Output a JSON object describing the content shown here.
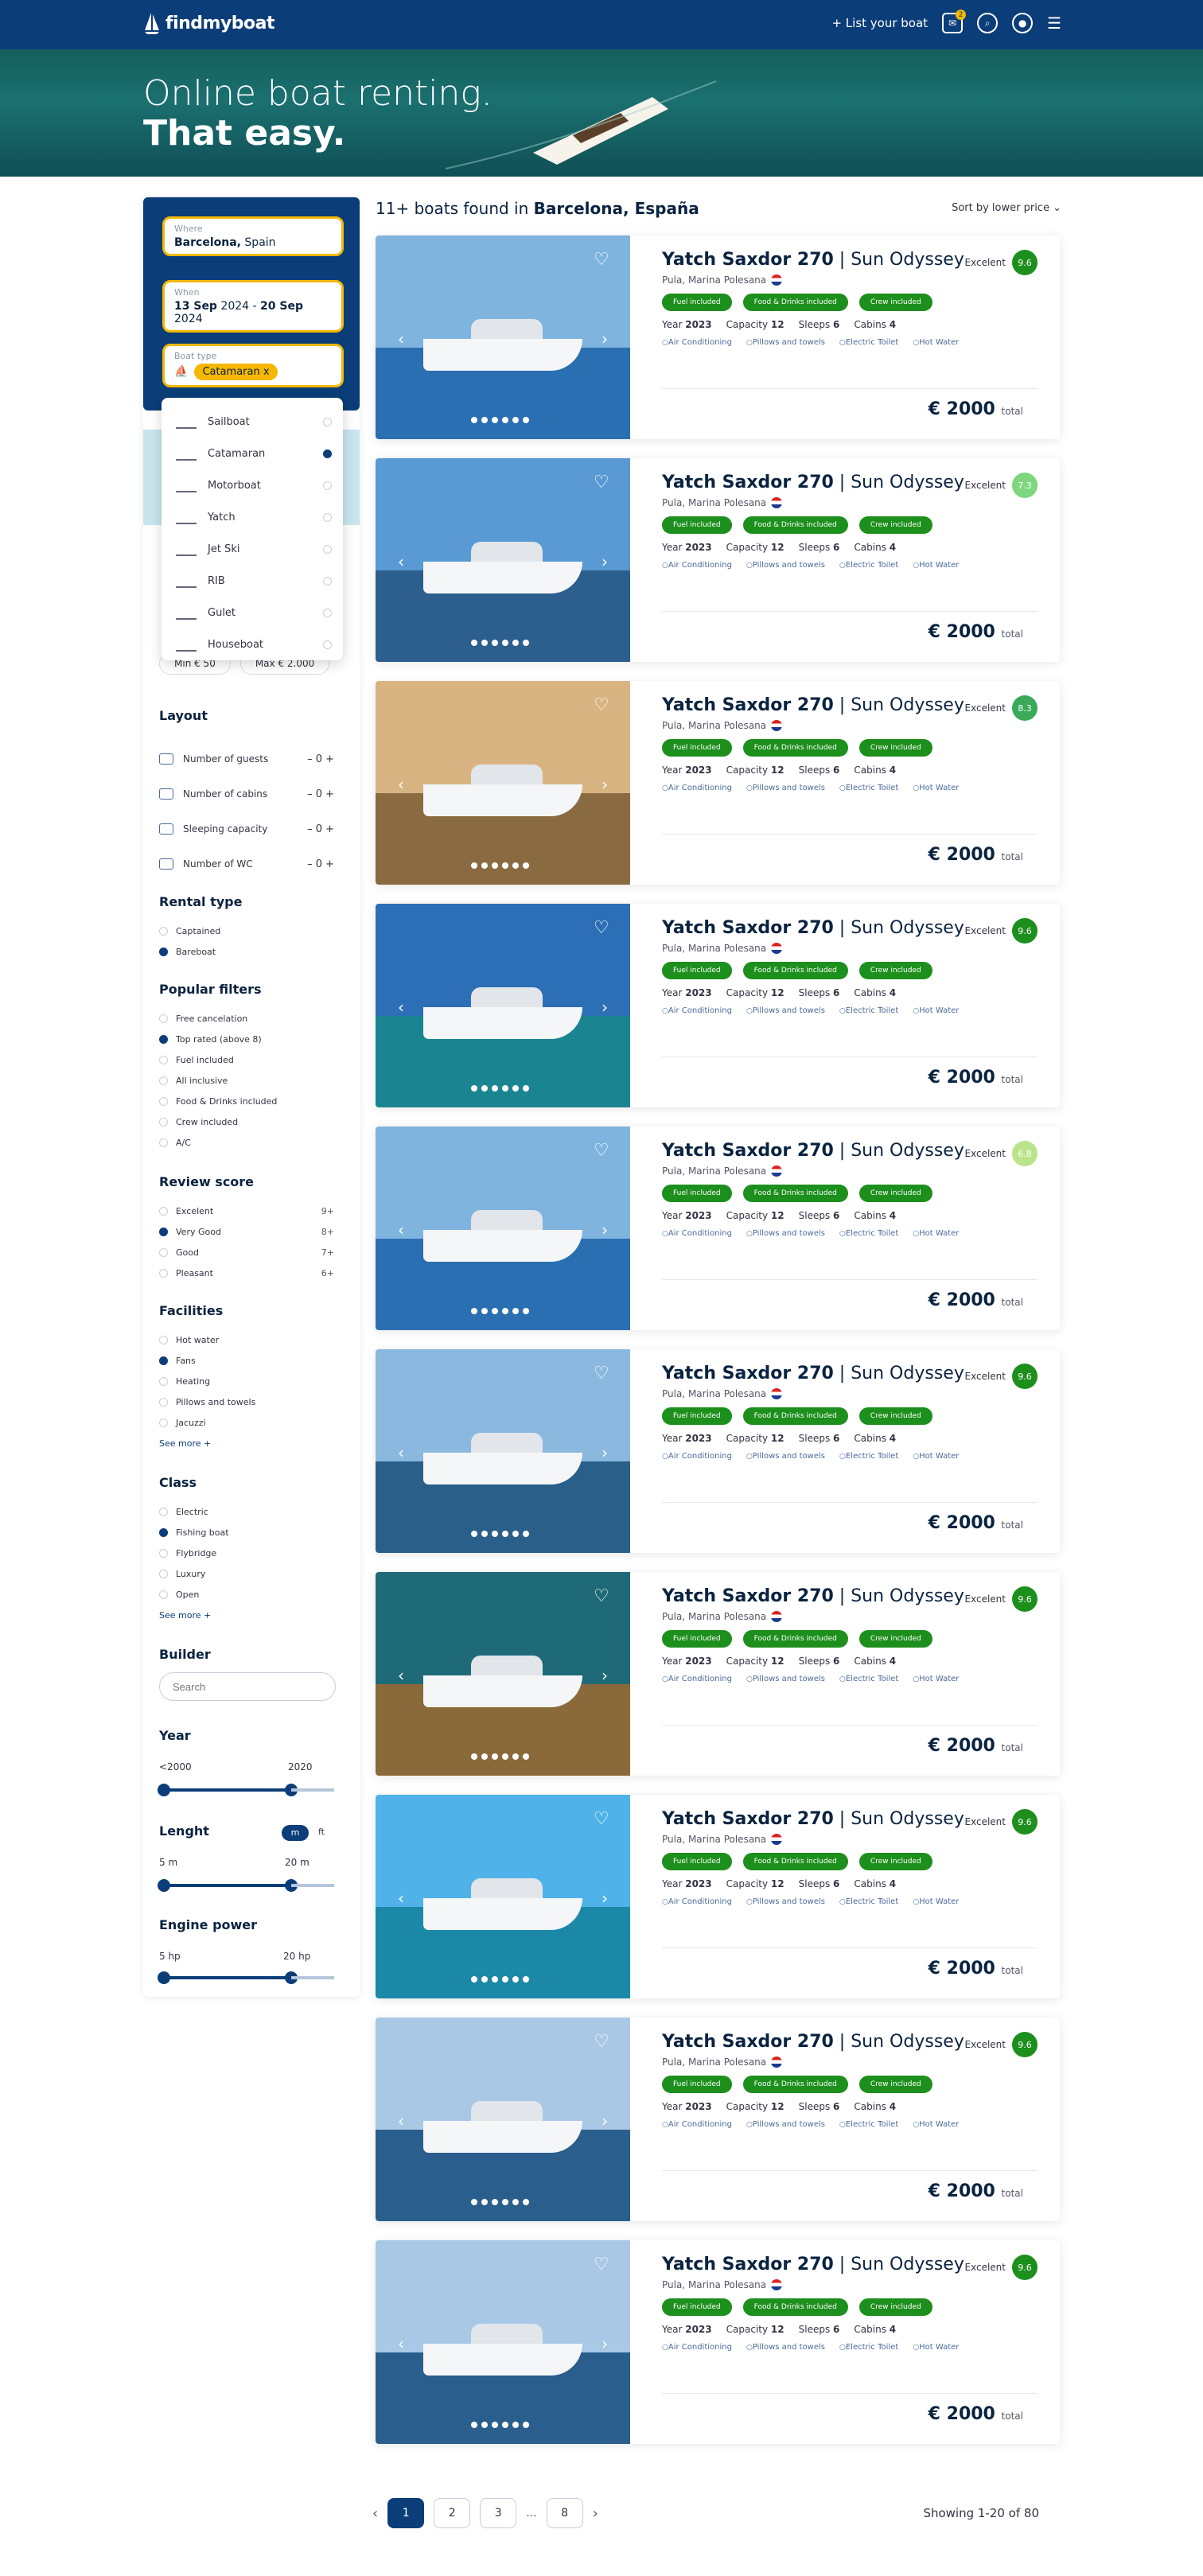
{
  "header": {
    "logo_text": "findmyboat",
    "list_label": "+ List your boat",
    "notif_count": "2",
    "icons": [
      "notification-icon",
      "search-icon",
      "user-icon",
      "menu-icon"
    ]
  },
  "hero": {
    "line1": "Online boat renting.",
    "line2": "That easy."
  },
  "search": {
    "where_label": "Where",
    "where_value_bold": "Barcelona,",
    "where_value": " Spain",
    "when_label": "When",
    "when_from": "13 Sep",
    "when_from_year": "2024",
    "when_sep": "-",
    "when_to": "20 Sep",
    "when_to_year": "2024",
    "type_label": "Boat type",
    "type_value": "Catamaran",
    "type_remove": "x"
  },
  "boat_types": [
    {
      "label": "Sailboat",
      "selected": false
    },
    {
      "label": "Catamaran",
      "selected": true
    },
    {
      "label": "Motorboat",
      "selected": false
    },
    {
      "label": "Yatch",
      "selected": false
    },
    {
      "label": "Jet Ski",
      "selected": false
    },
    {
      "label": "RIB",
      "selected": false
    },
    {
      "label": "Gulet",
      "selected": false
    },
    {
      "label": "Houseboat",
      "selected": false
    }
  ],
  "price": {
    "min": "Min € 50",
    "max": "Max € 2.000"
  },
  "layout": {
    "title": "Layout",
    "counters": [
      {
        "label": "Number of guests",
        "value": "– 0 +"
      },
      {
        "label": "Number of cabins",
        "value": "– 0 +"
      },
      {
        "label": "Sleeping capacity",
        "value": "– 0 +"
      },
      {
        "label": "Number of WC",
        "value": "– 0 +"
      }
    ]
  },
  "rental": {
    "title": "Rental type",
    "options": [
      {
        "label": "Captained",
        "on": false
      },
      {
        "label": "Bareboat",
        "on": true
      }
    ]
  },
  "popular": {
    "title": "Popular filters",
    "options": [
      {
        "label": "Free cancelation",
        "on": false
      },
      {
        "label": "Top rated (above 8)",
        "on": true
      },
      {
        "label": "Fuel included",
        "on": false
      },
      {
        "label": "All inclusive",
        "on": false
      },
      {
        "label": "Food & Drinks included",
        "on": false
      },
      {
        "label": "Crew included",
        "on": false
      },
      {
        "label": "A/C",
        "on": false
      }
    ]
  },
  "review": {
    "title": "Review score",
    "options": [
      {
        "label": "Excelent",
        "score": "9+",
        "on": false
      },
      {
        "label": "Very Good",
        "score": "8+",
        "on": true
      },
      {
        "label": "Good",
        "score": "7+",
        "on": false
      },
      {
        "label": "Pleasant",
        "score": "6+",
        "on": false
      }
    ]
  },
  "facilities": {
    "title": "Facilities",
    "options": [
      {
        "label": "Hot water",
        "on": false
      },
      {
        "label": "Fans",
        "on": true
      },
      {
        "label": "Heating",
        "on": false
      },
      {
        "label": "Pillows and towels",
        "on": false
      },
      {
        "label": "Jacuzzi",
        "on": false
      }
    ],
    "see_more": "See more +"
  },
  "class": {
    "title": "Class",
    "options": [
      {
        "label": "Electric",
        "on": false
      },
      {
        "label": "Fishing boat",
        "on": true
      },
      {
        "label": "Flybridge",
        "on": false
      },
      {
        "label": "Luxury",
        "on": false
      },
      {
        "label": "Open",
        "on": false
      }
    ],
    "see_more": "See more +"
  },
  "builder": {
    "title": "Builder",
    "placeholder": "Search"
  },
  "year": {
    "title": "Year",
    "min": "<2000",
    "max": "2020"
  },
  "length": {
    "title": "Lenght",
    "unit_on": "m",
    "unit_off": "ft",
    "min": "5 m",
    "max": "20 m"
  },
  "engine": {
    "title": "Engine power",
    "min": "5 hp",
    "max": "20 hp"
  },
  "results": {
    "count_text": "11+ boats found in ",
    "place": "Barcelona, España",
    "sort_label": "Sort by lower price"
  },
  "listing": {
    "name_bold": "Yatch Saxdor 270",
    "name_rest": " | Sun Odyssey",
    "location": "Pula, Marina Polesana",
    "tags": [
      "Fuel included",
      "Food & Drinks included",
      "Crew included"
    ],
    "specs": [
      {
        "k": "Year",
        "v": "2023"
      },
      {
        "k": "Capacity",
        "v": "12"
      },
      {
        "k": "Sleeps",
        "v": "6"
      },
      {
        "k": "Cabins",
        "v": "4"
      }
    ],
    "amenities": [
      "Air Conditioning",
      "Pillows and towels",
      "Electric Toilet",
      "Hot Water"
    ],
    "score_label": "Excelent",
    "price": "€ 2000",
    "price_suffix": "total"
  },
  "cards": [
    {
      "score": "9.6",
      "color": "#1d8f1d",
      "sky": "#7fb4df",
      "sea": "#2a6fb2"
    },
    {
      "score": "7.3",
      "color": "#7ed67e",
      "sky": "#5a9ad4",
      "sea": "#2c5f8d"
    },
    {
      "score": "8.3",
      "color": "#3aaa5a",
      "sky": "#d9b483",
      "sea": "#8a6a40"
    },
    {
      "score": "9.6",
      "color": "#1d8f1d",
      "sky": "#2c6fb6",
      "sea": "#1a8590"
    },
    {
      "score": "6.8",
      "color": "#b9e48a",
      "sky": "#7fb4df",
      "sea": "#2a6fb2"
    },
    {
      "score": "9.6",
      "color": "#1d8f1d",
      "sky": "#8ab8de",
      "sea": "#2a5f8a"
    },
    {
      "score": "9.6",
      "color": "#1d8f1d",
      "sky": "#1e6a78",
      "sea": "#8a6a3a"
    },
    {
      "score": "9.6",
      "color": "#1d8f1d",
      "sky": "#4fb2e8",
      "sea": "#1b88a8"
    },
    {
      "score": "9.6",
      "color": "#1d8f1d",
      "sky": "#a9c8e6",
      "sea": "#2a5e8c"
    },
    {
      "score": "9.6",
      "color": "#1d8f1d",
      "sky": "#a9c8e6",
      "sea": "#2a5e8c"
    }
  ],
  "pager": {
    "pages": [
      "1",
      "2",
      "3",
      "...",
      "8"
    ],
    "showing": "Showing 1-20 of 80"
  }
}
